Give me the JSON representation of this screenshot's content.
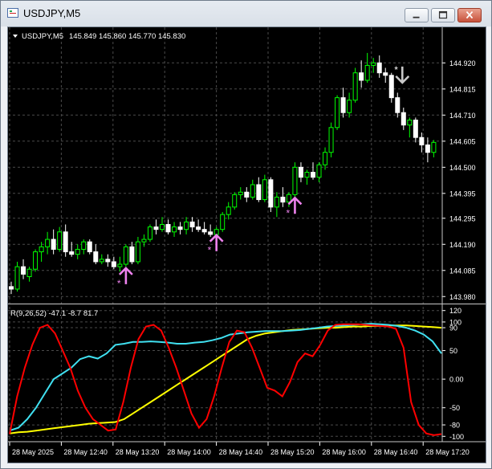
{
  "window": {
    "title": "USDJPY,M5"
  },
  "price_chart": {
    "header_symbol": "USDJPY,M5",
    "header_ohlc": "145.849 145.860 145.770 145.830",
    "price_ticks": [
      "144.920",
      "144.815",
      "144.710",
      "144.605",
      "144.500",
      "144.395",
      "144.295",
      "144.190",
      "144.085",
      "143.980"
    ],
    "price_tick_values": [
      144.92,
      144.815,
      144.71,
      144.605,
      144.5,
      144.395,
      144.295,
      144.19,
      144.085,
      143.98
    ],
    "up_arrow_color": "#ee82ee",
    "down_arrow_color": "#c8c8c8",
    "bull_color": "#00ff00",
    "bear_color": "#ffffff",
    "candles": [
      {
        "o": 144.02,
        "h": 144.04,
        "l": 143.99,
        "c": 144.01
      },
      {
        "o": 144.01,
        "h": 144.12,
        "l": 144.0,
        "c": 144.1
      },
      {
        "o": 144.1,
        "h": 144.13,
        "l": 144.05,
        "c": 144.07
      },
      {
        "o": 144.06,
        "h": 144.1,
        "l": 144.04,
        "c": 144.09
      },
      {
        "o": 144.09,
        "h": 144.17,
        "l": 144.08,
        "c": 144.16
      },
      {
        "o": 144.16,
        "h": 144.2,
        "l": 144.12,
        "c": 144.18
      },
      {
        "o": 144.18,
        "h": 144.24,
        "l": 144.15,
        "c": 144.21
      },
      {
        "o": 144.21,
        "h": 144.25,
        "l": 144.15,
        "c": 144.17
      },
      {
        "o": 144.17,
        "h": 144.26,
        "l": 144.16,
        "c": 144.24
      },
      {
        "o": 144.24,
        "h": 144.27,
        "l": 144.14,
        "c": 144.16
      },
      {
        "o": 144.16,
        "h": 144.2,
        "l": 144.14,
        "c": 144.15
      },
      {
        "o": 144.15,
        "h": 144.19,
        "l": 144.13,
        "c": 144.17
      },
      {
        "o": 144.17,
        "h": 144.21,
        "l": 144.15,
        "c": 144.2
      },
      {
        "o": 144.2,
        "h": 144.21,
        "l": 144.15,
        "c": 144.16
      },
      {
        "o": 144.16,
        "h": 144.19,
        "l": 144.11,
        "c": 144.12
      },
      {
        "o": 144.12,
        "h": 144.15,
        "l": 144.11,
        "c": 144.13
      },
      {
        "o": 144.13,
        "h": 144.15,
        "l": 144.1,
        "c": 144.12
      },
      {
        "o": 144.12,
        "h": 144.14,
        "l": 144.09,
        "c": 144.1
      },
      {
        "o": 144.1,
        "h": 144.14,
        "l": 144.08,
        "c": 144.11
      },
      {
        "o": 144.11,
        "h": 144.19,
        "l": 144.1,
        "c": 144.18
      },
      {
        "o": 144.18,
        "h": 144.2,
        "l": 144.11,
        "c": 144.12
      },
      {
        "o": 144.12,
        "h": 144.22,
        "l": 144.11,
        "c": 144.2
      },
      {
        "o": 144.2,
        "h": 144.23,
        "l": 144.18,
        "c": 144.21
      },
      {
        "o": 144.21,
        "h": 144.27,
        "l": 144.2,
        "c": 144.26
      },
      {
        "o": 144.26,
        "h": 144.29,
        "l": 144.23,
        "c": 144.25
      },
      {
        "o": 144.25,
        "h": 144.3,
        "l": 144.24,
        "c": 144.27
      },
      {
        "o": 144.27,
        "h": 144.29,
        "l": 144.23,
        "c": 144.24
      },
      {
        "o": 144.24,
        "h": 144.28,
        "l": 144.22,
        "c": 144.26
      },
      {
        "o": 144.26,
        "h": 144.28,
        "l": 144.23,
        "c": 144.25
      },
      {
        "o": 144.25,
        "h": 144.3,
        "l": 144.23,
        "c": 144.28
      },
      {
        "o": 144.28,
        "h": 144.3,
        "l": 144.24,
        "c": 144.26
      },
      {
        "o": 144.26,
        "h": 144.29,
        "l": 144.24,
        "c": 144.25
      },
      {
        "o": 144.25,
        "h": 144.28,
        "l": 144.23,
        "c": 144.24
      },
      {
        "o": 144.24,
        "h": 144.27,
        "l": 144.22,
        "c": 144.23
      },
      {
        "o": 144.23,
        "h": 144.26,
        "l": 144.2,
        "c": 144.25
      },
      {
        "o": 144.25,
        "h": 144.32,
        "l": 144.24,
        "c": 144.31
      },
      {
        "o": 144.31,
        "h": 144.36,
        "l": 144.29,
        "c": 144.34
      },
      {
        "o": 144.34,
        "h": 144.4,
        "l": 144.33,
        "c": 144.39
      },
      {
        "o": 144.39,
        "h": 144.42,
        "l": 144.37,
        "c": 144.4
      },
      {
        "o": 144.4,
        "h": 144.42,
        "l": 144.36,
        "c": 144.38
      },
      {
        "o": 144.38,
        "h": 144.45,
        "l": 144.37,
        "c": 144.43
      },
      {
        "o": 144.43,
        "h": 144.46,
        "l": 144.36,
        "c": 144.37
      },
      {
        "o": 144.37,
        "h": 144.47,
        "l": 144.36,
        "c": 144.45
      },
      {
        "o": 144.45,
        "h": 144.46,
        "l": 144.32,
        "c": 144.34
      },
      {
        "o": 144.34,
        "h": 144.4,
        "l": 144.3,
        "c": 144.38
      },
      {
        "o": 144.38,
        "h": 144.42,
        "l": 144.34,
        "c": 144.36
      },
      {
        "o": 144.36,
        "h": 144.4,
        "l": 144.34,
        "c": 144.39
      },
      {
        "o": 144.39,
        "h": 144.52,
        "l": 144.38,
        "c": 144.5
      },
      {
        "o": 144.5,
        "h": 144.52,
        "l": 144.44,
        "c": 144.46
      },
      {
        "o": 144.46,
        "h": 144.49,
        "l": 144.43,
        "c": 144.48
      },
      {
        "o": 144.48,
        "h": 144.52,
        "l": 144.45,
        "c": 144.46
      },
      {
        "o": 144.46,
        "h": 144.52,
        "l": 144.44,
        "c": 144.51
      },
      {
        "o": 144.51,
        "h": 144.58,
        "l": 144.49,
        "c": 144.56
      },
      {
        "o": 144.56,
        "h": 144.68,
        "l": 144.54,
        "c": 144.66
      },
      {
        "o": 144.66,
        "h": 144.79,
        "l": 144.65,
        "c": 144.78
      },
      {
        "o": 144.78,
        "h": 144.82,
        "l": 144.7,
        "c": 144.72
      },
      {
        "o": 144.72,
        "h": 144.8,
        "l": 144.7,
        "c": 144.77
      },
      {
        "o": 144.77,
        "h": 144.9,
        "l": 144.76,
        "c": 144.88
      },
      {
        "o": 144.88,
        "h": 144.93,
        "l": 144.82,
        "c": 144.85
      },
      {
        "o": 144.85,
        "h": 144.96,
        "l": 144.84,
        "c": 144.91
      },
      {
        "o": 144.91,
        "h": 144.94,
        "l": 144.88,
        "c": 144.92
      },
      {
        "o": 144.92,
        "h": 144.95,
        "l": 144.86,
        "c": 144.88
      },
      {
        "o": 144.88,
        "h": 144.9,
        "l": 144.84,
        "c": 144.87
      },
      {
        "o": 144.87,
        "h": 144.88,
        "l": 144.76,
        "c": 144.78
      },
      {
        "o": 144.78,
        "h": 144.8,
        "l": 144.7,
        "c": 144.72
      },
      {
        "o": 144.72,
        "h": 144.74,
        "l": 144.65,
        "c": 144.67
      },
      {
        "o": 144.67,
        "h": 144.7,
        "l": 144.62,
        "c": 144.69
      },
      {
        "o": 144.69,
        "h": 144.7,
        "l": 144.6,
        "c": 144.62
      },
      {
        "o": 144.62,
        "h": 144.64,
        "l": 144.56,
        "c": 144.59
      },
      {
        "o": 144.59,
        "h": 144.62,
        "l": 144.52,
        "c": 144.56
      },
      {
        "o": 144.56,
        "h": 144.61,
        "l": 144.54,
        "c": 144.6
      }
    ],
    "signals": [
      {
        "index": 19,
        "dir": "up",
        "price": 144.062
      },
      {
        "index": 34,
        "dir": "up",
        "price": 144.195
      },
      {
        "index": 47,
        "dir": "up",
        "price": 144.345
      },
      {
        "index": 64,
        "dir": "down",
        "price": 144.86
      }
    ]
  },
  "indicator": {
    "label": "R(9,26,52) -47.1 -8.7 81.7",
    "ticks": [
      "120",
      "100",
      "90",
      "50",
      "0.00",
      "-50",
      "-80",
      "-100"
    ],
    "tick_values": [
      120,
      100,
      90,
      50,
      0,
      -50,
      -80,
      -100
    ],
    "red_color": "#ff0000",
    "cyan_color": "#40e0f0",
    "yellow_color": "#ffff00",
    "red": [
      -96,
      -30,
      20,
      60,
      90,
      95,
      80,
      50,
      20,
      -20,
      -50,
      -70,
      -80,
      -90,
      -88,
      -40,
      20,
      70,
      92,
      95,
      85,
      55,
      20,
      -20,
      -60,
      -85,
      -70,
      -30,
      20,
      65,
      85,
      82,
      55,
      20,
      -15,
      -20,
      -30,
      -5,
      30,
      45,
      40,
      60,
      85,
      95,
      96,
      96,
      96,
      95,
      94,
      93,
      92,
      88,
      55,
      -40,
      -80,
      -95,
      -98,
      -96
    ],
    "cyan": [
      -90,
      -85,
      -70,
      -50,
      -25,
      0,
      10,
      20,
      35,
      40,
      36,
      45,
      60,
      62,
      65,
      65,
      66,
      65,
      64,
      62,
      62,
      64,
      65,
      68,
      72,
      78,
      80,
      82,
      83,
      84,
      84,
      84,
      85,
      86,
      88,
      90,
      92,
      93,
      94,
      95,
      96,
      97,
      96,
      95,
      93,
      90,
      85,
      78,
      66,
      45
    ],
    "yellow": [
      -95,
      -93,
      -92,
      -90,
      -88,
      -86,
      -84,
      -82,
      -80,
      -78,
      -77,
      -76,
      -75,
      -70,
      -60,
      -50,
      -40,
      -30,
      -20,
      -10,
      0,
      10,
      20,
      30,
      40,
      50,
      60,
      70,
      76,
      80,
      82,
      84,
      86,
      87,
      88,
      89,
      90,
      90,
      91,
      92,
      92,
      93,
      93,
      94,
      94,
      94,
      93,
      92,
      91,
      90
    ]
  },
  "time_axis": {
    "labels": [
      "28 May 2025",
      "28 May 12:40",
      "28 May 13:20",
      "28 May 14:00",
      "28 May 14:40",
      "28 May 15:20",
      "28 May 16:00",
      "28 May 16:40",
      "28 May 17:20"
    ]
  },
  "colors": {
    "background": "#000000",
    "grid": "#4a4a4a",
    "axis_text": "#ffffff"
  }
}
